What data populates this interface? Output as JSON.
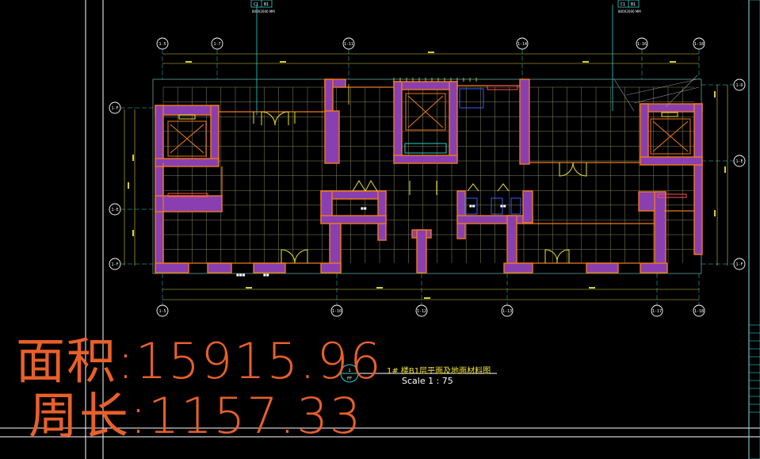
{
  "grid_top": [
    "1-5",
    "1-7",
    "1-11",
    "1-14",
    "1-16",
    "1-18"
  ],
  "grid_bottom": [
    "1-5",
    "1-10",
    "1-12",
    "1-13",
    "1-17",
    "1-18"
  ],
  "grid_left": [
    "1-F",
    "1-E",
    "1-F"
  ],
  "grid_right": [
    "1-D",
    "1-E",
    "1-F"
  ],
  "tag_left": {
    "c1": "C1",
    "c2": "B1",
    "note": "800X2000 MM"
  },
  "tag_right": {
    "c1": "C1",
    "c2": "B1",
    "note": "800X2000 MM"
  },
  "stats": {
    "area": "面积:15915.96",
    "perimeter": "周长:1157.33"
  },
  "drawing_title": {
    "number": "1",
    "sheet": "FF",
    "name": "1# 楼B1层平面及地面材料图",
    "scale": "Scale 1 : 75"
  },
  "colors": {
    "wall_fill": "#8a3fb0",
    "wall_edge": "#f07a1a",
    "grid": "#3a8f8a",
    "axis": "#2ed0d0",
    "dim": "#d6cf3a",
    "door": "#e8e23a"
  }
}
